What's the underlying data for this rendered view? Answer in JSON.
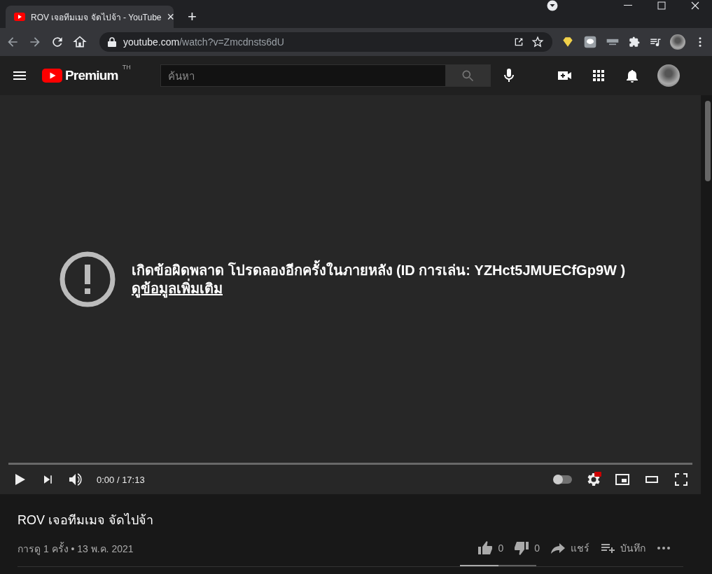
{
  "browser": {
    "tab": {
      "title": "ROV เจอทีมเมจ จัดไปจ้า - YouTube",
      "close": "×"
    },
    "new_tab": "+",
    "address": {
      "host": "youtube.com",
      "path": "/watch?v=Zmcdnsts6dU"
    }
  },
  "header": {
    "logo": "Premium",
    "region": "TH",
    "search": {
      "placeholder": "ค้นหา"
    }
  },
  "player": {
    "error": {
      "message": "เกิดข้อผิดพลาด โปรดลองอีกครั้งในภายหลัง (ID การเล่น: YZHct5JMUECfGp9W )",
      "link": "ดูข้อมูลเพิ่มเติม"
    },
    "progress": {
      "level": 0
    },
    "time": "0:00 / 17:13",
    "autoplay": {
      "on": false
    }
  },
  "video": {
    "title": "ROV เจอทีมเมจ จัดไปจ้า",
    "meta": "การดู 1 ครั้ง • 13 พ.ค. 2021",
    "likes": "0",
    "dislikes": "0",
    "share": "แชร์",
    "save": "บันทึก",
    "sentiment": {
      "level": 0.5
    }
  }
}
